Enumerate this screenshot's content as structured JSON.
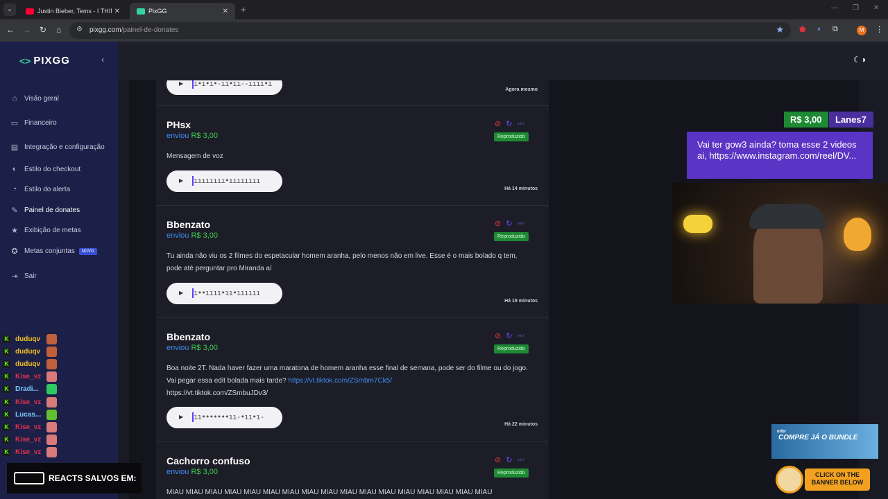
{
  "browser": {
    "tabs": [
      {
        "title": "Justin Bieber, Tems - I THINK YOU",
        "favicon_color": "#ff0033"
      },
      {
        "title": "PixGG",
        "favicon_color": "#32d4a0"
      }
    ],
    "new_tab": "+",
    "url_host": "pixgg.com",
    "url_path": "/painel-de-donates",
    "profile_initial": "M"
  },
  "app": {
    "logo_mark": "<>",
    "logo_text": "PIXGG",
    "nav": [
      {
        "label": "Visão geral",
        "icon": "home-icon",
        "glyph": "⌂"
      },
      {
        "label": "Financeiro",
        "icon": "wallet-icon",
        "glyph": "▭"
      },
      {
        "label": "Integração e configuração",
        "icon": "settings-icon",
        "glyph": "▤"
      },
      {
        "label": "Estilo do checkout",
        "icon": "palette-icon",
        "glyph": "◐"
      },
      {
        "label": "Estilo do alerta",
        "icon": "alert-style-icon",
        "glyph": "◔"
      },
      {
        "label": "Painel de donates",
        "icon": "megaphone-icon",
        "glyph": "✎"
      },
      {
        "label": "Exibição de metas",
        "icon": "star-icon",
        "glyph": "★"
      },
      {
        "label": "Metas conjuntas",
        "icon": "goals-icon",
        "glyph": "✪",
        "badge": "NOVO"
      },
      {
        "label": "Sair",
        "icon": "logout-icon",
        "glyph": "⇥"
      }
    ]
  },
  "donations": [
    {
      "time": "Agora mesmo"
    },
    {
      "name": "PHsx",
      "sent_word": "enviou",
      "amount": "R$ 3,00",
      "status": "Reproduzido",
      "message": "Mensagem de voz",
      "time": "Há 14 minutos"
    },
    {
      "name": "Bbenzato",
      "sent_word": "enviou",
      "amount": "R$ 3,00",
      "status": "Reproduzido",
      "message": "Tu ainda não viu os 2 filmes do espetacular homem aranha, pelo menos não em live. Esse é o mais bolado q tem, pode até perguntar pro Miranda aí",
      "time": "Há 19 minutos"
    },
    {
      "name": "Bbenzato",
      "sent_word": "enviou",
      "amount": "R$ 3,00",
      "status": "Reproduzido",
      "message": "Boa noite 2T. Nada haver fazer uma maratona de homem aranha esse final de semana, pode ser do filme ou do jogo. Vai pegar essa edit bolada mais tarde? ",
      "message_link": "https://vt.tiktok.com/ZSmbm7Ck5/",
      "message_tail": "https://vt.tiktok.com/ZSmbuJDv3/",
      "time": "Há 22 minutos"
    },
    {
      "name": "Cachorro confuso",
      "sent_word": "enviou",
      "amount": "R$ 3,00",
      "status": "Reproduzido",
      "message": "MIAU MIAU MIAU MIAU MIAU MIAU MIAU MIAU MIAU MIAU MIAU MIAU MIAU MIAU MIAU MIAU MIAU"
    }
  ],
  "overlay": {
    "alert_amount": "R$ 3,00",
    "alert_user": "Lanes7",
    "alert_message": "Vai ter gow3 ainda? toma esse 2 videos ai, https://www.instagram.com/reel/DV...",
    "chat": [
      {
        "name": "duduqv",
        "color": "#f0c020",
        "emote": "#c0603a"
      },
      {
        "name": "duduqv",
        "color": "#f0c020",
        "emote": "#c0603a"
      },
      {
        "name": "duduqv",
        "color": "#f0c020",
        "emote": "#c0603a"
      },
      {
        "name": "Kise_vz",
        "color": "#e0304a",
        "emote": "#d87a7a"
      },
      {
        "name": "Dradi...",
        "color": "#7ac8ff",
        "emote": "#30c860"
      },
      {
        "name": "Kise_vz",
        "color": "#e0304a",
        "emote": "#d87a7a"
      },
      {
        "name": "Lucas...",
        "color": "#7ac8ff",
        "emote": "#60c030"
      },
      {
        "name": "Kise_vz",
        "color": "#e0304a",
        "emote": "#d87a7a"
      },
      {
        "name": "Kise_vz",
        "color": "#e0304a",
        "emote": "#d87a7a"
      },
      {
        "name": "Kise_vz",
        "color": "#e0304a",
        "emote": "#d87a7a"
      }
    ],
    "reacts_text": "REACTS SALVOS EM:",
    "promo_small": "mibr",
    "promo_text": "COMPRE JÁ O BUNDLE",
    "click_banner": "CLICK ON THE BANNER BELOW"
  }
}
